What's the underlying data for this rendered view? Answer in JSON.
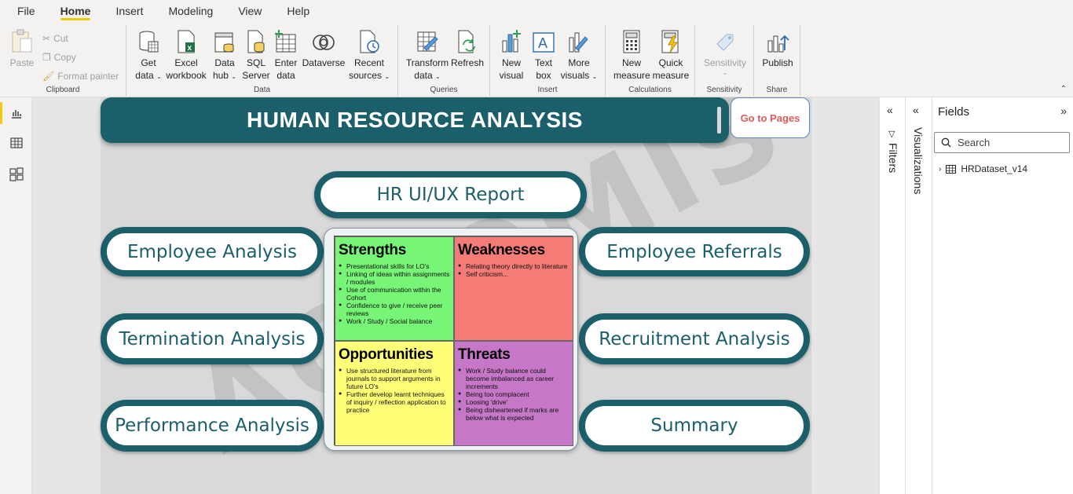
{
  "menu": [
    "File",
    "Home",
    "Insert",
    "Modeling",
    "View",
    "Help"
  ],
  "ribbon": {
    "clipboard": {
      "label": "Clipboard",
      "paste": "Paste",
      "cut": "Cut",
      "copy": "Copy",
      "format_painter": "Format painter"
    },
    "data": {
      "label": "Data",
      "get_data": [
        "Get",
        "data"
      ],
      "excel": [
        "Excel",
        "workbook"
      ],
      "data_hub": [
        "Data",
        "hub"
      ],
      "sql": [
        "SQL",
        "Server"
      ],
      "enter": [
        "Enter",
        "data"
      ],
      "dataverse": [
        "Dataverse",
        ""
      ],
      "recent": [
        "Recent",
        "sources"
      ]
    },
    "queries": {
      "label": "Queries",
      "transform": [
        "Transform",
        "data"
      ],
      "refresh": [
        "Refresh",
        ""
      ]
    },
    "insert": {
      "label": "Insert",
      "new_visual": [
        "New",
        "visual"
      ],
      "text_box": [
        "Text",
        "box"
      ],
      "more_visuals": [
        "More",
        "visuals"
      ]
    },
    "calculations": {
      "label": "Calculations",
      "new_measure": [
        "New",
        "measure"
      ],
      "quick_measure": [
        "Quick",
        "measure"
      ]
    },
    "sensitivity": {
      "label": "Sensitivity",
      "btn": "Sensitivity"
    },
    "share": {
      "label": "Share",
      "publish": "Publish"
    }
  },
  "canvas": {
    "title": "HUMAN RESOURCE ANALYSIS",
    "go_to_pages": "Go to Pages",
    "watermark": "ACTOMIS",
    "report_button": "HR UI/UX Report",
    "left_buttons": [
      "Employee Analysis",
      "Termination Analysis",
      "Performance Analysis"
    ],
    "right_buttons": [
      "Employee Referrals",
      "Recruitment Analysis",
      "Summary"
    ]
  },
  "swot": {
    "strengths": {
      "title": "Strengths",
      "items": [
        "Presentational skills for LO's",
        "Linking of ideas within assignments / modules",
        "Use of communication within the Cohort",
        "Confidence to give / receive peer reviews",
        "Work / Study / Social balance"
      ]
    },
    "weaknesses": {
      "title": "Weaknesses",
      "items": [
        "Relating theory directly to literature",
        "Self criticism..."
      ]
    },
    "opportunities": {
      "title": "Opportunities",
      "items": [
        "Use structured literature from journals to support arguments in future LO's",
        "Further develop learnt techniques of inquiry / reflection application to practice"
      ]
    },
    "threats": {
      "title": "Threats",
      "items": [
        "Work / Study balance could become imbalanced as career increments",
        "Being too complacent",
        "Loosing 'drive'",
        "Being disheartened if marks are below what is expected"
      ]
    }
  },
  "panes": {
    "filters": "Filters",
    "visualizations": "Visualizations",
    "fields": "Fields",
    "search_placeholder": "Search",
    "dataset": "HRDataset_v14"
  },
  "colors": {
    "teal": "#1a5f6a",
    "accent": "#f2c811"
  }
}
